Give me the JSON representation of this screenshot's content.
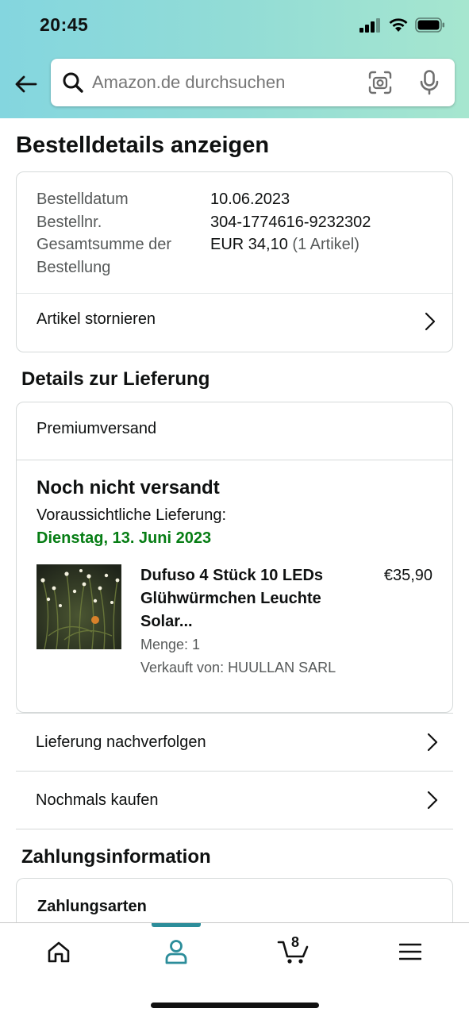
{
  "status_bar": {
    "time": "20:45"
  },
  "search": {
    "placeholder": "Amazon.de durchsuchen"
  },
  "page": {
    "title": "Bestelldetails anzeigen"
  },
  "order_summary": {
    "date_label": "Bestelldatum",
    "date_value": "10.06.2023",
    "number_label": "Bestellnr.",
    "number_value": "304-1774616-9232302",
    "total_label_line1": "Gesamtsumme der",
    "total_label_line2": "Bestellung",
    "total_value": "EUR 34,10",
    "total_items": "(1 Artikel)",
    "cancel_label": "Artikel stornieren"
  },
  "delivery": {
    "section_title": "Details zur Lieferung",
    "shipping_type": "Premiumversand",
    "status": "Noch nicht versandt",
    "estimate_label": "Voraussichtliche Lieferung:",
    "estimate_date": "Dienstag, 13. Juni 2023",
    "item": {
      "title": "Dufuso 4 Stück 10 LEDs Glühwürmchen Leuchte Solar...",
      "price": "€35,90",
      "quantity": "Menge: 1",
      "seller": "Verkauft von: HUULLAN SARL"
    },
    "track_label": "Lieferung nachverfolgen",
    "buy_again_label": "Nochmals kaufen"
  },
  "payment": {
    "section_title": "Zahlungsinformation",
    "methods_title": "Zahlungsarten"
  },
  "tabbar": {
    "active_tab": "account",
    "cart_count": "8",
    "accent_color": "#2c8d9a"
  },
  "colors": {
    "header_gradient_start": "#84d6df",
    "header_gradient_end": "#a6e6cf",
    "delivery_green": "#067d14"
  }
}
